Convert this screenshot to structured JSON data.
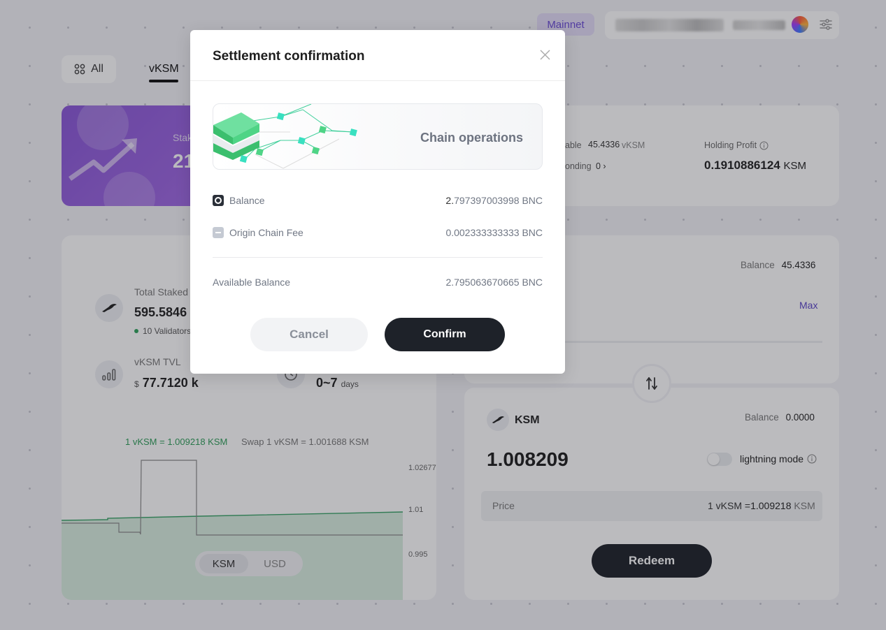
{
  "header": {
    "network": "Mainnet"
  },
  "tabs": {
    "all_label": "All",
    "vksm_label": "vKSM"
  },
  "stake_card": {
    "label": "Stak",
    "value": "21"
  },
  "holdings": {
    "available_label": "able",
    "available_value": "45.4336",
    "available_unit": "vKSM",
    "unbonding_label": "onding",
    "unbonding_value": "0 ›",
    "profit_label": "Holding Profit",
    "profit_value": "0.1910886124",
    "profit_unit": "KSM"
  },
  "stats": {
    "total_staked_label": "Total Staked",
    "total_staked_value": "595.5846",
    "validators": "10 Validators",
    "tvl_label": "vKSM TVL",
    "tvl_currency": "$",
    "tvl_value": "77.7120 k",
    "period_value": "0~7",
    "period_unit": "days"
  },
  "chart": {
    "rate_text": "1 vKSM = 1.009218 KSM",
    "swap_text": "Swap 1 vKSM = 1.001688 KSM",
    "toggle_ksm": "KSM",
    "toggle_usd": "USD",
    "colors": {
      "rate": "#2f9e5a",
      "fill": "#d8eee0",
      "swap": "#777777"
    }
  },
  "chart_data": {
    "type": "line",
    "yticks": [
      "1.02677",
      "1.01",
      "0.995"
    ]
  },
  "swap_from": {
    "balance_label": "Balance",
    "balance_value": "45.4336",
    "max_label": "Max"
  },
  "swap_to": {
    "token": "KSM",
    "balance_label": "Balance",
    "balance_value": "0.0000",
    "amount": "1.008209",
    "lightning_label": "lightning mode",
    "price_label": "Price",
    "price_prefix": "1 vKSM =",
    "price_value": "1.009218",
    "price_unit": "KSM",
    "redeem_label": "Redeem"
  },
  "modal": {
    "title": "Settlement confirmation",
    "chain_label": "Chain operations",
    "balance_label": "Balance",
    "balance_lead": "2.",
    "balance_rest": "797397003998",
    "balance_unit": "BNC",
    "fee_label": "Origin Chain Fee",
    "fee_value": "0.002333333333",
    "fee_unit": "BNC",
    "available_label": "Available Balance",
    "available_value": "2.795063670665",
    "available_unit": "BNC",
    "cancel_label": "Cancel",
    "confirm_label": "Confirm"
  }
}
